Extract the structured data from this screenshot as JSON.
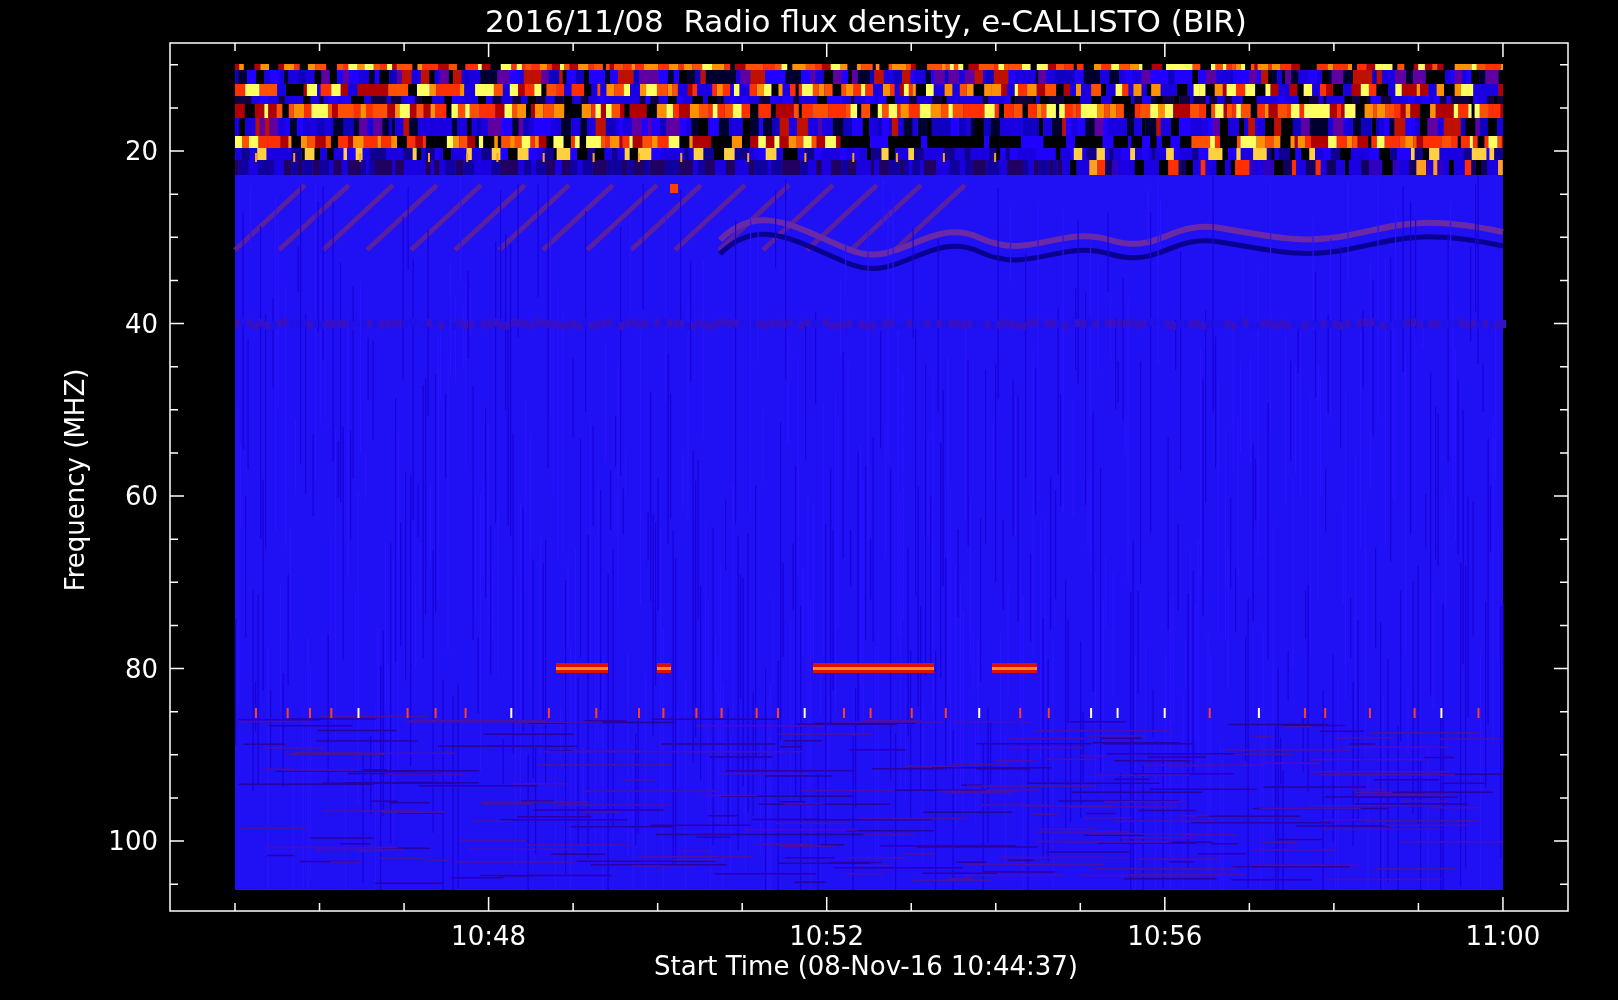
{
  "title": "2016/11/08  Radio flux density, e-CALLISTO (BIR)",
  "y_axis": {
    "label": "Frequency (MHZ)",
    "ticks": [
      "20",
      "40",
      "60",
      "80",
      "100"
    ]
  },
  "x_axis": {
    "label": "Start Time (08-Nov-16 10:44:37)",
    "ticks": [
      "10:48",
      "10:52",
      "10:56",
      "11:00"
    ]
  }
}
